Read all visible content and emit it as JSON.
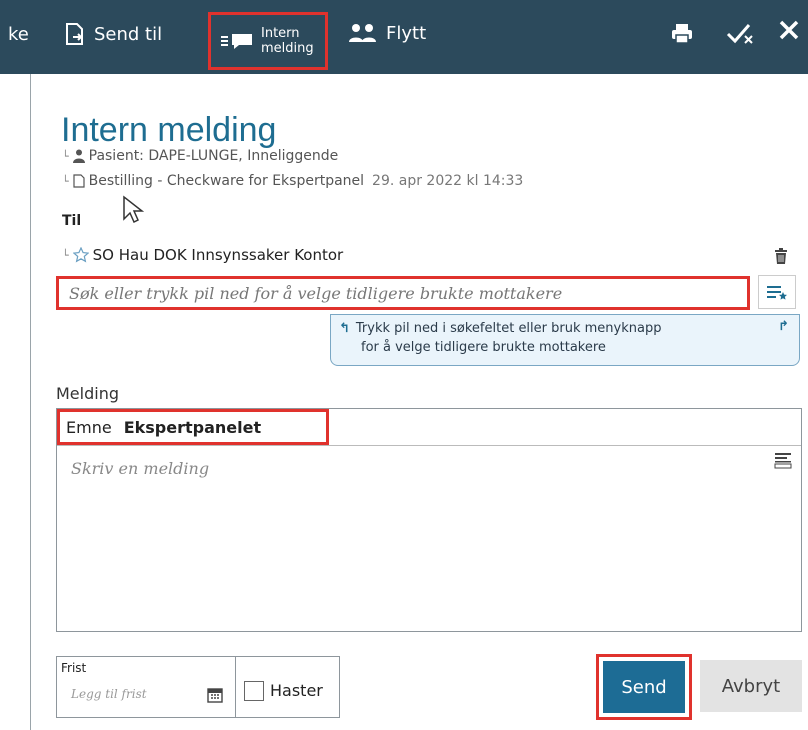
{
  "toolbar": {
    "fragment_label": "ke",
    "send_til_label": "Send til",
    "intern_line1": "Intern",
    "intern_line2": "melding",
    "flytt_label": "Flytt"
  },
  "header": {
    "title": "Intern melding",
    "patient": "Pasient: DAPE-LUNGE, Inneliggende",
    "order": "Bestilling - Checkware for Ekspertpanel",
    "order_date": "29. apr 2022 kl 14:33"
  },
  "recipients": {
    "label": "Til",
    "items": [
      {
        "name": "SO Hau DOK Innsynssaker Kontor"
      }
    ],
    "search_placeholder": "Søk eller trykk pil ned for å velge tidligere brukte mottakere"
  },
  "hint": {
    "line1": "Trykk pil ned i søkefeltet eller bruk menyknapp",
    "line2": "for å velge tidligere brukte mottakere"
  },
  "message": {
    "label": "Melding",
    "subject_label": "Emne",
    "subject_value": "Ekspertpanelet",
    "body_placeholder": "Skriv en melding"
  },
  "footer": {
    "deadline_label": "Frist",
    "deadline_placeholder": "Legg til frist",
    "urgent_label": "Haster",
    "send_label": "Send",
    "cancel_label": "Avbryt"
  },
  "colors": {
    "toolbar_bg": "#2c4a5c",
    "title": "#1e6d91",
    "highlight": "#e0322d",
    "send_bg": "#1d6c95"
  }
}
